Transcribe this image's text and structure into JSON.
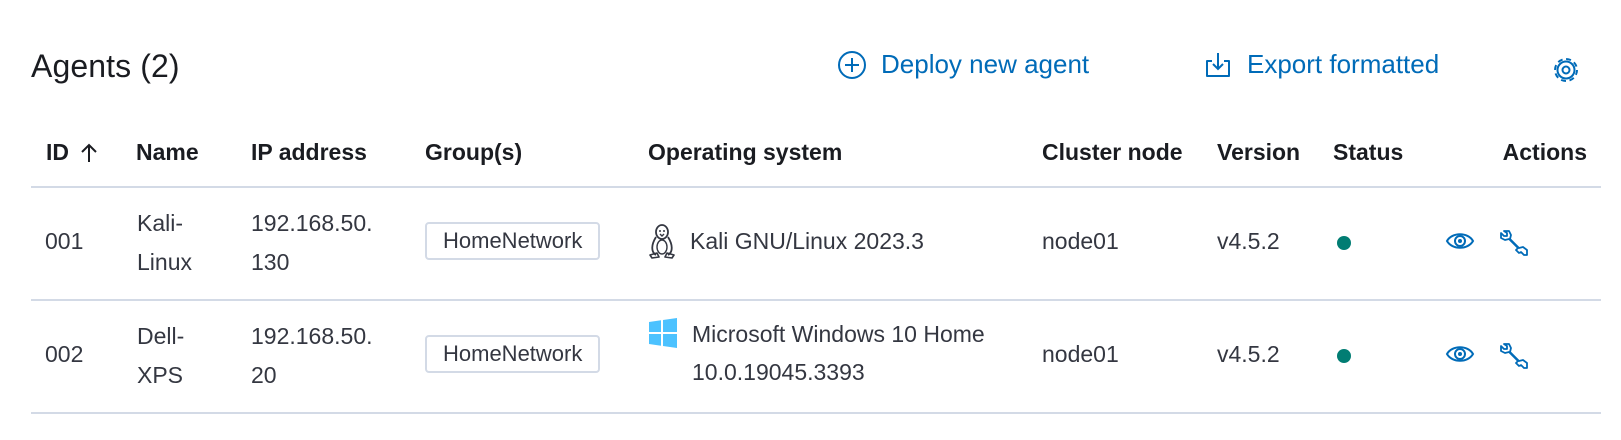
{
  "header": {
    "title": "Agents (2)",
    "deploy_label": "Deploy new agent",
    "export_label": "Export formatted"
  },
  "table": {
    "columns": {
      "id": "ID",
      "name": "Name",
      "ip": "IP address",
      "groups": "Group(s)",
      "os": "Operating system",
      "node": "Cluster node",
      "version": "Version",
      "status": "Status",
      "actions": "Actions"
    },
    "rows": [
      {
        "id": "001",
        "name_line1": "Kali-",
        "name_line2": "Linux",
        "ip_line1": "192.168.50.",
        "ip_line2": "130",
        "group": "HomeNetwork",
        "os_icon": "linux-icon",
        "os_line1": "Kali GNU/Linux 2023.3",
        "os_line2": "",
        "node": "node01",
        "version": "v4.5.2",
        "status": "active"
      },
      {
        "id": "002",
        "name_line1": "Dell-",
        "name_line2": "XPS",
        "ip_line1": "192.168.50.",
        "ip_line2": "20",
        "group": "HomeNetwork",
        "os_icon": "windows-icon",
        "os_line1": "Microsoft Windows 10 Home",
        "os_line2": "10.0.19045.3393",
        "node": "node01",
        "version": "v4.5.2",
        "status": "active"
      }
    ]
  },
  "colors": {
    "link": "#006bb8",
    "status_active": "#017d73",
    "border": "#d3dae6",
    "windows": "#4cc2ff"
  }
}
